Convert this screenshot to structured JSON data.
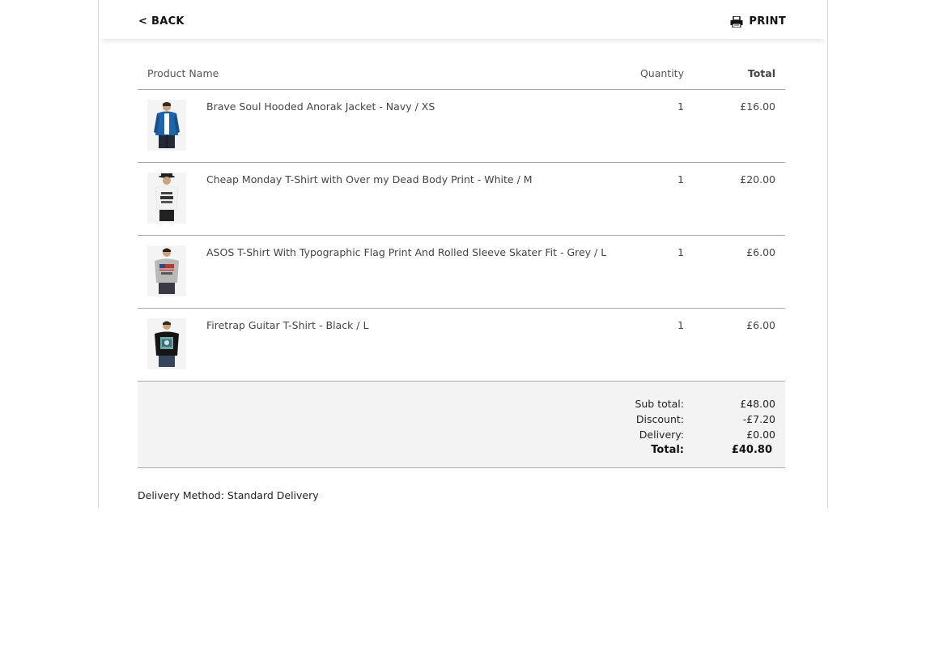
{
  "header": {
    "back_label": "< BACK",
    "print_label": "PRINT",
    "print_icon": "printer-icon"
  },
  "table": {
    "columns": {
      "name": "Product Name",
      "quantity": "Quantity",
      "total": "Total"
    },
    "items": [
      {
        "name": "Brave Soul Hooded Anorak Jacket - Navy / XS",
        "quantity": "1",
        "total": "£16.00",
        "thumb": "blue-hooded-jacket-image",
        "color": "#1e64a8"
      },
      {
        "name": "Cheap Monday T-Shirt with Over my Dead Body Print - White / M",
        "quantity": "1",
        "total": "£20.00",
        "thumb": "white-tshirt-image",
        "color": "#f2f2f2"
      },
      {
        "name": "ASOS T-Shirt With Typographic Flag Print And Rolled Sleeve Skater Fit - Grey / L",
        "quantity": "1",
        "total": "£6.00",
        "thumb": "grey-flag-tshirt-image",
        "color": "#b9b9b9"
      },
      {
        "name": "Firetrap Guitar T-Shirt - Black / L",
        "quantity": "1",
        "total": "£6.00",
        "thumb": "black-guitar-tshirt-image",
        "color": "#151515"
      }
    ]
  },
  "summary": {
    "subtotal_label": "Sub total:",
    "subtotal_value": "£48.00",
    "discount_label": "Discount:",
    "discount_value": "-£7.20",
    "delivery_label": "Delivery:",
    "delivery_value": "£0.00",
    "total_label": "Total:",
    "total_value": "£40.80"
  },
  "delivery_method": "Delivery Method: Standard Delivery"
}
